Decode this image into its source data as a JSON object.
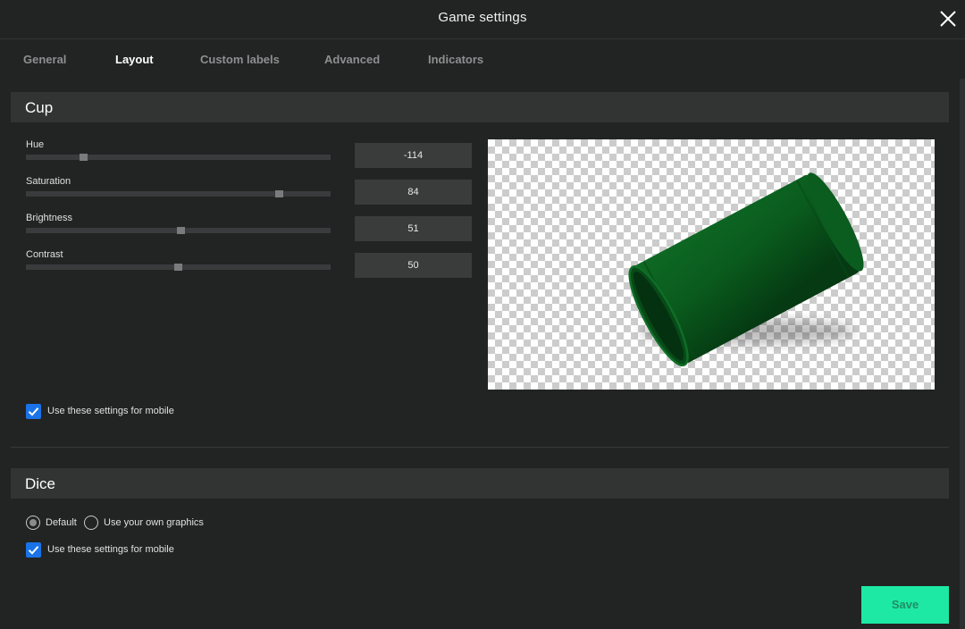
{
  "header": {
    "title": "Game settings",
    "close_icon": "close-icon"
  },
  "tabs": [
    {
      "label": "General",
      "active": false
    },
    {
      "label": "Layout",
      "active": true
    },
    {
      "label": "Custom labels",
      "active": false
    },
    {
      "label": "Advanced",
      "active": false
    },
    {
      "label": "Indicators",
      "active": false
    }
  ],
  "cup": {
    "title": "Cup",
    "sliders": [
      {
        "label": "Hue",
        "value": "-114",
        "fraction": 0.18
      },
      {
        "label": "Saturation",
        "value": "84",
        "fraction": 0.84
      },
      {
        "label": "Brightness",
        "value": "51",
        "fraction": 0.51
      },
      {
        "label": "Contrast",
        "value": "50",
        "fraction": 0.5
      }
    ],
    "mobile_checkbox": {
      "label": "Use these settings for mobile",
      "checked": true
    },
    "preview_color": "#0a5a1e"
  },
  "dice": {
    "title": "Dice",
    "radio_default": {
      "label": "Default",
      "selected": true
    },
    "radio_custom": {
      "label": "Use your own graphics",
      "selected": false
    },
    "mobile_checkbox": {
      "label": "Use these settings for mobile",
      "checked": true
    }
  },
  "save_label": "Save",
  "colors": {
    "background": "#222323",
    "section": "#323333",
    "accent": "#1de9a5",
    "checkbox": "#1a73e8"
  }
}
